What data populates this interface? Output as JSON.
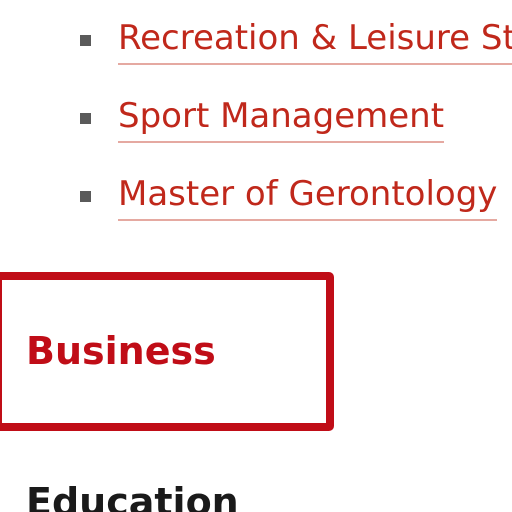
{
  "programs": [
    {
      "label": "Recreation & Leisure Studie"
    },
    {
      "label": "Sport Management"
    },
    {
      "label": "Master of Gerontology"
    }
  ],
  "sections": {
    "business": "Business",
    "education": "Education"
  },
  "colors": {
    "link": "#c0281b",
    "highlight_border": "#c00d17",
    "heading_dark": "#1a1a1a",
    "bullet": "#5a5a5a"
  }
}
